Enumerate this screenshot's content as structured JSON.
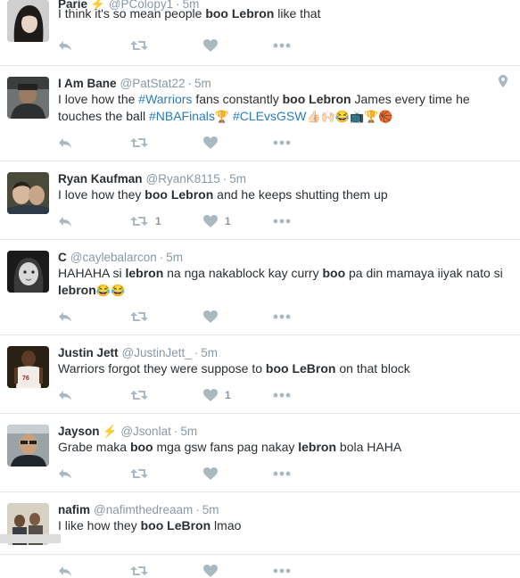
{
  "tweets": [
    {
      "name": "Parie",
      "has_bolt": true,
      "handle": "@PColopy1",
      "time": "5m",
      "parts": [
        {
          "t": "I think it's so mean people "
        },
        {
          "t": "boo Lebron",
          "b": true
        },
        {
          "t": " like that"
        }
      ],
      "rt_count": "",
      "like_count": "",
      "avatar": "woman-dark-hair"
    },
    {
      "name": "I Am Bane",
      "has_bolt": false,
      "handle": "@PatStat22",
      "time": "5m",
      "location_icon": true,
      "parts": [
        {
          "t": "I love how the "
        },
        {
          "t": "#Warriors",
          "tag": true
        },
        {
          "t": " fans constantly "
        },
        {
          "t": "boo Lebron",
          "b": true
        },
        {
          "t": " James every time he touches the ball "
        },
        {
          "t": "#NBAFinals",
          "tag": true
        },
        {
          "t": "🏆",
          "e": true
        },
        {
          "t": " "
        },
        {
          "t": "#CLEvsGSW",
          "tag": true
        },
        {
          "t": " 👍🏻🙌🏻😂📺🏆🏀",
          "e": true
        }
      ],
      "rt_count": "",
      "like_count": "",
      "avatar": "man-hat"
    },
    {
      "name": "Ryan Kaufman",
      "has_bolt": false,
      "handle": "@RyanK8115",
      "time": "5m",
      "parts": [
        {
          "t": "I love how they "
        },
        {
          "t": "boo Lebron",
          "b": true
        },
        {
          "t": " and he keeps shutting them up"
        }
      ],
      "rt_count": "1",
      "like_count": "1",
      "avatar": "couple"
    },
    {
      "name": "C",
      "has_bolt": false,
      "handle": "@caylebalarcon",
      "time": "5m",
      "parts": [
        {
          "t": "HAHAHA si "
        },
        {
          "t": "lebron",
          "b": true
        },
        {
          "t": " na nga nakablock kay curry "
        },
        {
          "t": "boo",
          "b": true
        },
        {
          "t": " pa din mamaya iiyak nato si "
        },
        {
          "t": "lebron",
          "b": true
        },
        {
          "t": " 😂😂",
          "e": true
        }
      ],
      "rt_count": "",
      "like_count": "",
      "avatar": "bw-child"
    },
    {
      "name": "Justin Jett",
      "has_bolt": false,
      "handle": "@JustinJett_",
      "time": "5m",
      "parts": [
        {
          "t": "Warriors forgot they were suppose to "
        },
        {
          "t": "boo LeBron",
          "b": true
        },
        {
          "t": " on that block"
        }
      ],
      "rt_count": "",
      "like_count": "1",
      "avatar": "player"
    },
    {
      "name": "Jayson",
      "has_bolt": true,
      "handle": "@Jsonlat",
      "time": "5m",
      "parts": [
        {
          "t": "Grabe maka "
        },
        {
          "t": "boo",
          "b": true
        },
        {
          "t": " mga gsw fans pag nakay "
        },
        {
          "t": "lebron",
          "b": true
        },
        {
          "t": " bola HAHA"
        }
      ],
      "rt_count": "",
      "like_count": "",
      "avatar": "man-selfie"
    },
    {
      "name": "nafim",
      "has_bolt": false,
      "handle": "@nafimthedreaam",
      "time": "5m",
      "parts": [
        {
          "t": "I like how they "
        },
        {
          "t": "boo LeBron",
          "b": true
        },
        {
          "t": " lmao"
        }
      ],
      "rt_count": "",
      "like_count": "",
      "avatar": "group"
    }
  ],
  "sep": "·",
  "bolt_glyph": "⚡"
}
